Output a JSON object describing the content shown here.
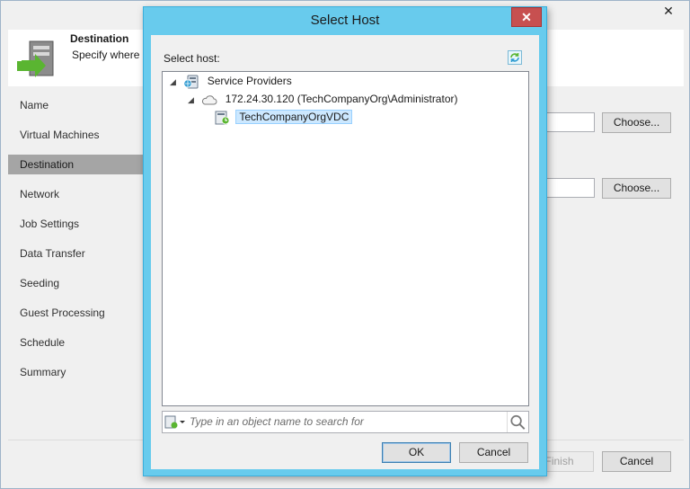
{
  "wizard": {
    "close_glyph": "✕",
    "header": {
      "title": "Destination",
      "subtitle": "Specify where r",
      "icon": "destination-arrow-server-icon"
    },
    "steps": [
      {
        "label": "Name"
      },
      {
        "label": "Virtual Machines"
      },
      {
        "label": "Destination",
        "active": true
      },
      {
        "label": "Network"
      },
      {
        "label": "Job Settings"
      },
      {
        "label": "Data Transfer"
      },
      {
        "label": "Seeding"
      },
      {
        "label": "Guest Processing"
      },
      {
        "label": "Schedule"
      },
      {
        "label": "Summary"
      }
    ],
    "choose_button_1": "Choose...",
    "choose_button_2": "Choose...",
    "finish_button": "Finish",
    "cancel_button": "Cancel"
  },
  "dialog": {
    "title": "Select Host",
    "close_glyph": "✕",
    "select_label": "Select host:",
    "tree": [
      {
        "label": "Service Providers",
        "icon": "service-providers-icon",
        "expanded": true
      },
      {
        "label": "172.24.30.120 (TechCompanyOrg\\Administrator)",
        "icon": "cloud-icon",
        "expanded": true
      },
      {
        "label": "TechCompanyOrgVDC",
        "icon": "vdc-icon",
        "selected": true
      }
    ],
    "search_placeholder": "Type in an object name to search for",
    "ok_button": "OK",
    "cancel_button": "Cancel"
  },
  "colors": {
    "dialog_frame": "#68cbed",
    "close_button": "#c75050",
    "selection": "#cce8ff",
    "active_step": "#a5a5a5",
    "accent_green": "#5ab531"
  }
}
